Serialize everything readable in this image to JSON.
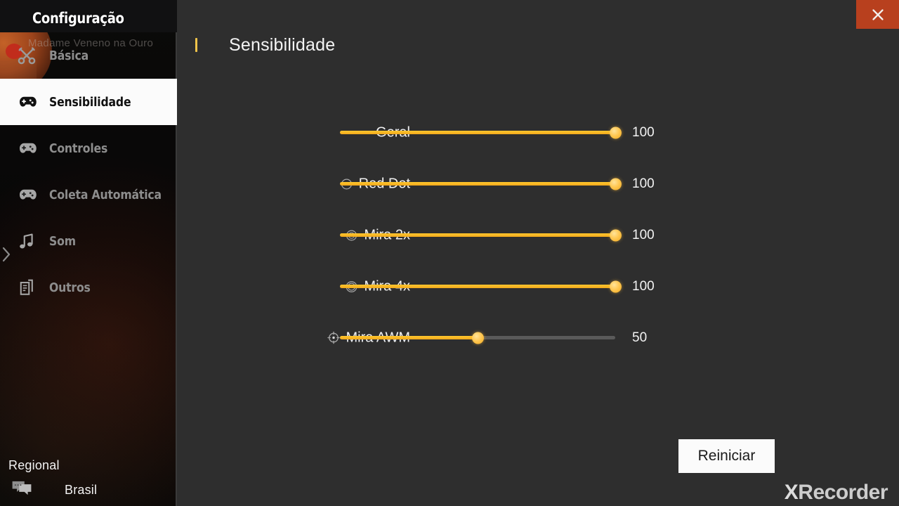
{
  "window": {
    "close_label": "✕",
    "close_icon": "close-icon",
    "close_color": "#b8401e"
  },
  "sidebar": {
    "title": "Configuração",
    "ghost_text": "Madame Veneno  na Ouro",
    "collapse_icon": "chevron-right-icon",
    "items": [
      {
        "label": "Básica",
        "icon": "tools-icon",
        "active": false
      },
      {
        "label": "Sensibilidade",
        "icon": "gamepad-icon",
        "active": true
      },
      {
        "label": "Controles",
        "icon": "gamepad-icon",
        "active": false
      },
      {
        "label": "Coleta Automática",
        "icon": "gamepad-icon",
        "active": false
      },
      {
        "label": "Som",
        "icon": "music-note-icon",
        "active": false
      },
      {
        "label": "Outros",
        "icon": "documents-icon",
        "active": false
      }
    ],
    "regional": {
      "label": "Regional",
      "value": "Brasil",
      "icon": "chat-bubble-icon"
    }
  },
  "main": {
    "title": "Sensibilidade",
    "accent_color": "#f0c44a",
    "reset_label": "Reiniciar",
    "sliders": [
      {
        "label": "Geral",
        "icon": "none",
        "value": 100,
        "max": 100,
        "display": "100"
      },
      {
        "label": "Red Dot",
        "icon": "reddot-icon",
        "value": 100,
        "max": 100,
        "display": "100"
      },
      {
        "label": "Mira 2x",
        "icon": "scope2x-icon",
        "value": 100,
        "max": 100,
        "display": "100"
      },
      {
        "label": "Mira 4x",
        "icon": "scope4x-icon",
        "value": 100,
        "max": 100,
        "display": "100"
      },
      {
        "label": "Mira AWM",
        "icon": "crosshair-icon",
        "value": 50,
        "max": 100,
        "display": "50"
      }
    ]
  },
  "watermark": {
    "x": "X",
    "text": "Recorder"
  }
}
